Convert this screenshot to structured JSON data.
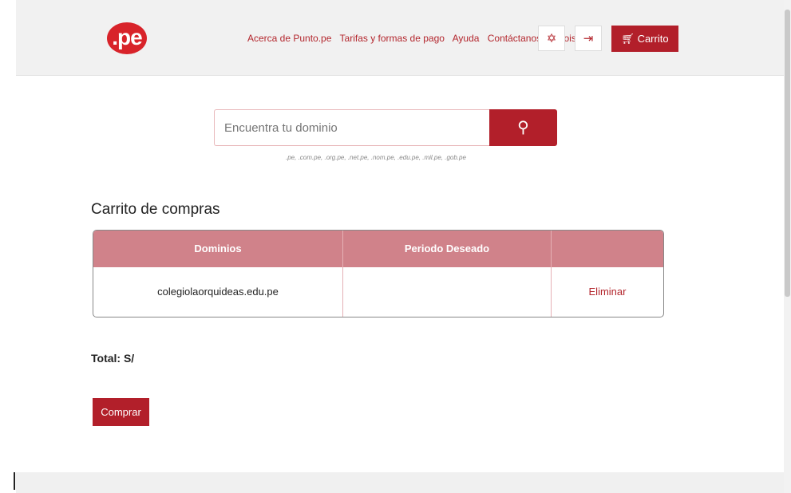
{
  "header": {
    "logo_text": ".pe",
    "nav": [
      "Acerca de Punto.pe",
      "Tarifas y formas de pago",
      "Ayuda",
      "Contáctanos",
      "Whois"
    ],
    "cart_label": "Carrito",
    "icons": [
      "settings-icon",
      "login-icon",
      "cart-icon"
    ]
  },
  "search": {
    "placeholder": "Encuentra tu dominio",
    "tlds": ".pe, .com.pe, .org.pe, .net.pe, .nom.pe, .edu.pe, .mil.pe, .gob.pe"
  },
  "cart": {
    "title": "Carrito de compras",
    "columns": [
      "Dominios",
      "Periodo Deseado",
      ""
    ],
    "rows": [
      {
        "domain": "colegiolaorquideas.edu.pe",
        "period": "",
        "action": "Eliminar"
      }
    ],
    "total_label": "Total: S/",
    "buy_label": "Comprar"
  },
  "colors": {
    "accent": "#b21f2a",
    "header_row": "#d0828a",
    "logo": "#d8232a"
  }
}
